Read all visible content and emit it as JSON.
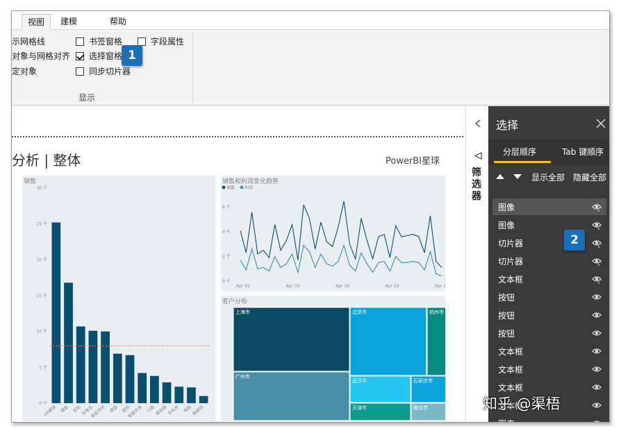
{
  "ribbon": {
    "tabs": [
      {
        "label": "视图",
        "active": true
      },
      {
        "label": "建模",
        "active": false
      },
      {
        "label": "帮助",
        "active": false
      }
    ],
    "options": {
      "show_gridlines": "示网格线",
      "snap_to_grid": "对象与网格对齐",
      "lock_objects": "定对象",
      "bookmarks_pane": {
        "label": "书签窗格",
        "checked": false
      },
      "selection_pane": {
        "label": "选择窗格",
        "checked": true
      },
      "sync_slicers": {
        "label": "同步切片器",
        "checked": false
      },
      "field_properties": {
        "label": "字段属性",
        "checked": false
      }
    },
    "group_label": "显示"
  },
  "callouts": {
    "one": "1",
    "two": "2"
  },
  "report": {
    "title": "分析 | 整体",
    "brand": "PowerBI星球"
  },
  "bar_panel_title": "销售",
  "line_panel": {
    "title": "销售和利润变化趋势",
    "legend": [
      "销售",
      "利润"
    ]
  },
  "treemap_panel": {
    "title": "客户分布"
  },
  "chart_data": [
    {
      "type": "bar",
      "title": "销售",
      "categories": [
        "VR眼镜",
        "键盘",
        "耳机",
        "充电宝",
        "智能手环",
        "键盘",
        "鼠标",
        "智能手表",
        "U盘",
        "路由器",
        "手机壳",
        "电脑",
        "数据线"
      ],
      "values": [
        25.2,
        16.8,
        10.7,
        10.1,
        10.0,
        6.9,
        6.7,
        4.2,
        3.8,
        2.9,
        2.3,
        2.2,
        1.0
      ],
      "y_ticks": [
        "0 千",
        "5 千",
        "10 千",
        "15 千",
        "20 千",
        "25 千",
        "30 千"
      ],
      "ylim": [
        0,
        30
      ],
      "reference_line": 8,
      "color": "#0a4f6e"
    },
    {
      "type": "line",
      "title": "销售和利润变化趋势",
      "x_ticks": [
        "Apr 02",
        "Apr 09",
        "Apr 16",
        "Apr 23",
        "Apr 30"
      ],
      "y_ticks": [
        "0 千",
        "2 千",
        "4 千",
        "6 千"
      ],
      "ylim": [
        0,
        7
      ],
      "series": [
        {
          "name": "销售",
          "color": "#0a4f6e",
          "values": [
            4.1,
            2.3,
            5.6,
            2.2,
            2.5,
            1.9,
            4.6,
            2.5,
            3.3,
            4.6,
            1.7,
            6.2,
            5.1,
            2.6,
            4.8,
            3.2,
            2.8,
            4.4,
            6.5,
            3.0,
            1.8,
            5.1,
            3.3,
            1.8,
            3.6,
            3.8,
            1.9,
            4.5,
            3.6,
            3.7,
            3.8,
            3.6,
            2.3,
            5.3,
            1.6,
            1.1
          ]
        },
        {
          "name": "利润",
          "color": "#3a8ea8",
          "values": [
            1.7,
            0.9,
            2.6,
            1.0,
            1.1,
            0.8,
            2.0,
            1.1,
            1.4,
            2.2,
            0.7,
            2.9,
            2.4,
            1.1,
            2.2,
            1.4,
            1.2,
            1.6,
            2.9,
            1.3,
            0.8,
            2.3,
            1.4,
            0.7,
            1.5,
            1.6,
            0.8,
            2.0,
            1.5,
            1.5,
            1.6,
            1.5,
            0.9,
            2.4,
            0.6,
            0.4
          ]
        }
      ]
    },
    {
      "type": "treemap",
      "title": "客户分布",
      "cells": [
        {
          "label": "上海市",
          "color": "#0b4a63"
        },
        {
          "label": "北京市",
          "color": "#0ba3db"
        },
        {
          "label": "杭州市",
          "color": "#0b8a82"
        },
        {
          "label": "广州市",
          "color": "#4a8fa8"
        },
        {
          "label": "武汉市",
          "color": "#22c6ef"
        },
        {
          "label": "石家庄市",
          "color": "#0ba3db"
        },
        {
          "label": "天津市",
          "color": "#0b9b8f"
        },
        {
          "label": "南京市",
          "color": "#7cb9c9"
        },
        {
          "label": "",
          "color": "#c7c7c7"
        }
      ]
    }
  ],
  "filter_strip": {
    "label": "筛选器"
  },
  "selection_pane": {
    "title": "选择",
    "tabs": [
      "分层顺序",
      "Tab 键顺序"
    ],
    "show_all": "显示全部",
    "hide_all": "隐藏全部",
    "layers": [
      "图像",
      "图像",
      "切片器",
      "切片器",
      "文本框",
      "按钮",
      "按钮",
      "按钮",
      "文本框",
      "文本框",
      "文本框",
      "文本框",
      "图表"
    ],
    "eye_style": [
      "eye-cycle-icon",
      "eye-cycle-icon",
      "eye-cycle-icon",
      "eye-cycle-icon",
      "eye-cycle-icon",
      "eye-icon",
      "eye-icon",
      "eye-icon",
      "eye-icon",
      "eye-icon",
      "eye-icon",
      "eye-icon",
      "eye-icon"
    ]
  },
  "watermark": "知乎 @渠梧",
  "colors": {
    "accent_yellow": "#f2c811",
    "pane_bg": "#3a3a3a",
    "callout_blue": "#1b6fb8"
  }
}
